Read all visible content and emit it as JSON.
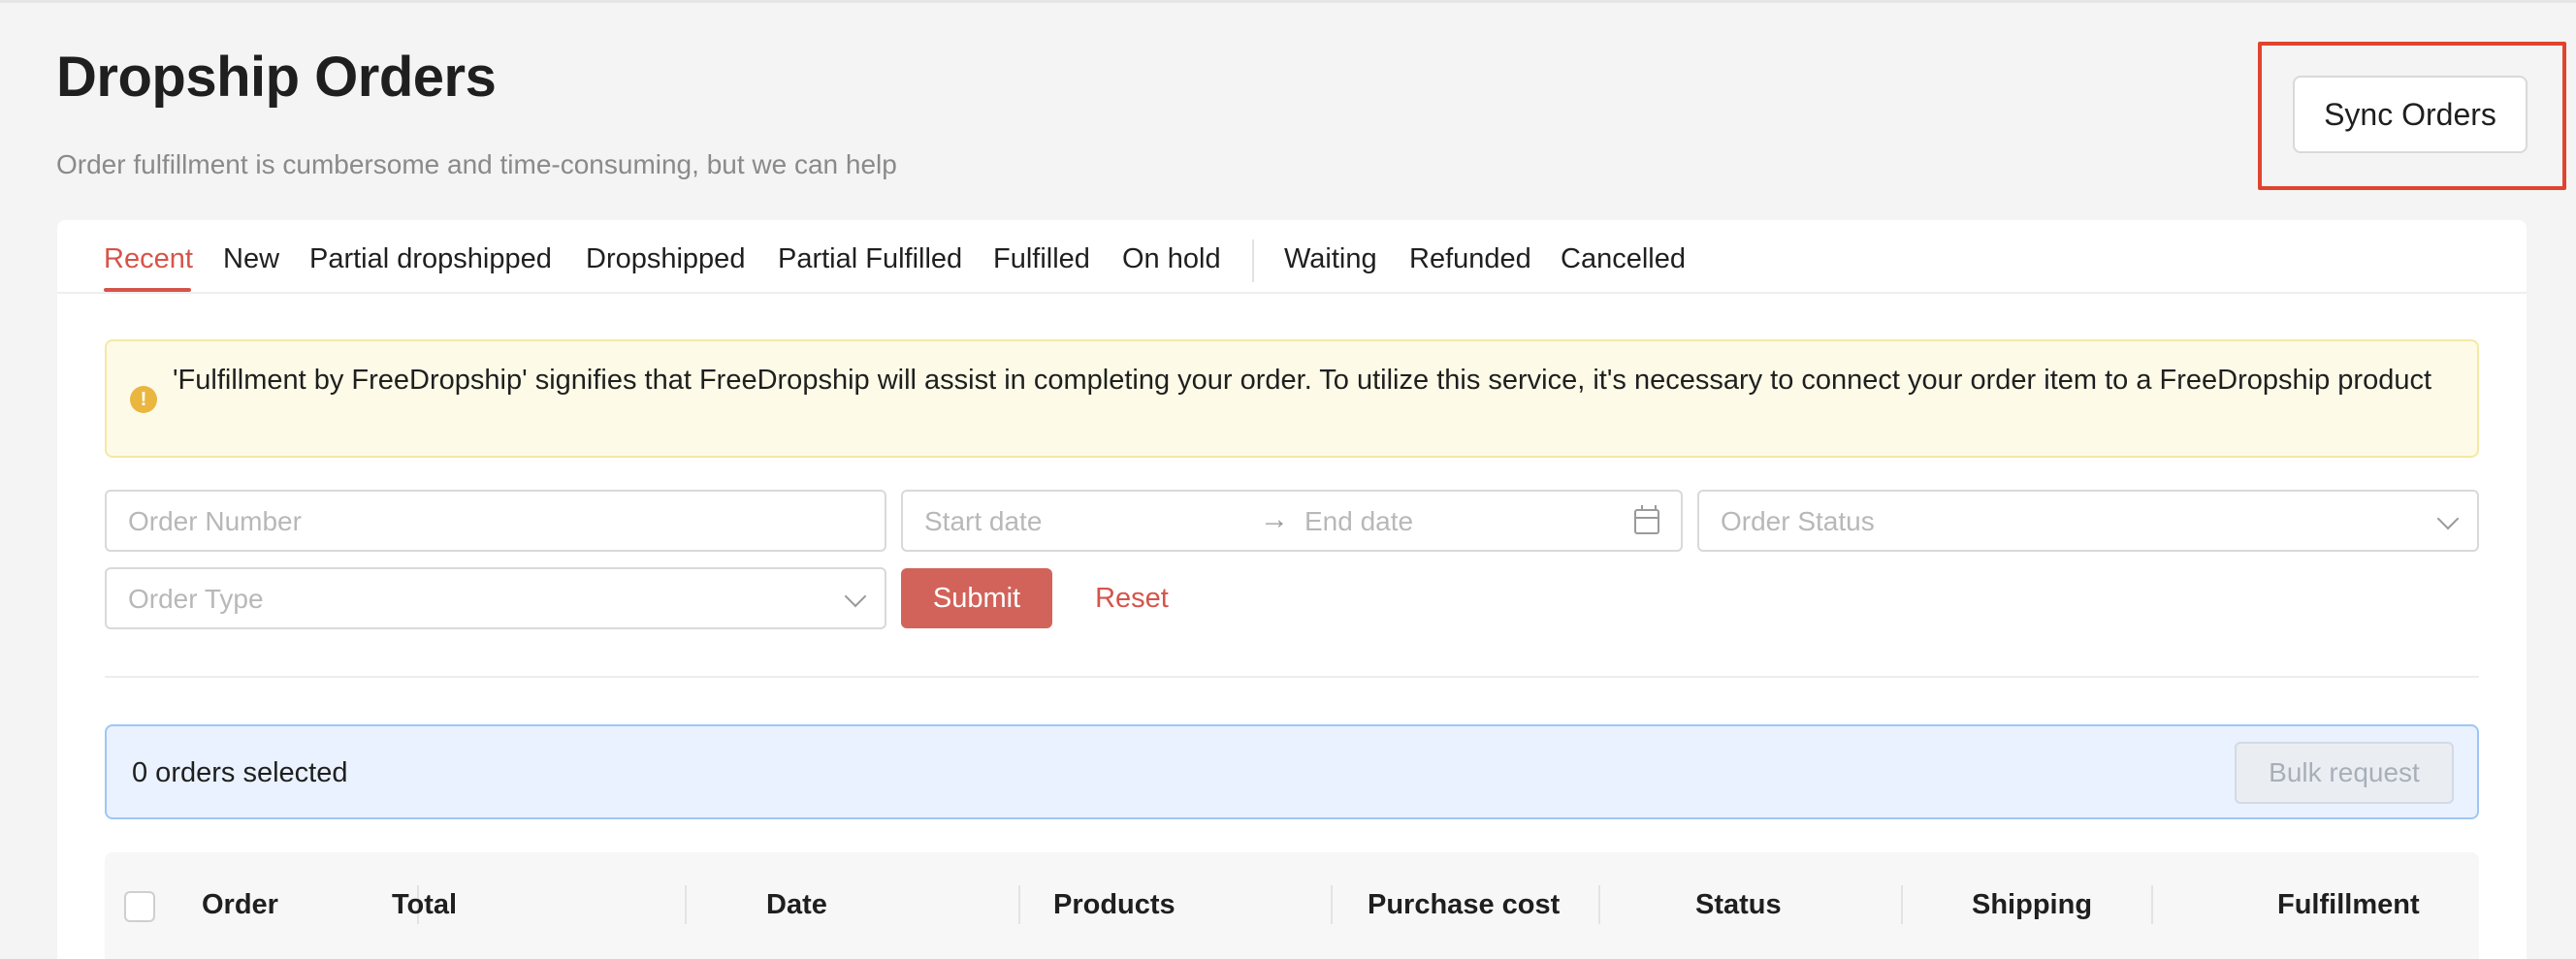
{
  "page": {
    "title": "Dropship Orders",
    "subtitle": "Order fulfillment is cumbersome and time-consuming, but we can help",
    "sync_button": "Sync Orders"
  },
  "tabs": [
    {
      "label": "Recent",
      "active": true
    },
    {
      "label": "New"
    },
    {
      "label": "Partial dropshipped"
    },
    {
      "label": "Dropshipped"
    },
    {
      "label": "Partial Fulfilled"
    },
    {
      "label": "Fulfilled"
    },
    {
      "label": "On hold"
    },
    {
      "label": "Waiting"
    },
    {
      "label": "Refunded"
    },
    {
      "label": "Cancelled"
    }
  ],
  "alert": {
    "icon": "warning-icon",
    "text": "'Fulfillment by FreeDropship' signifies that FreeDropship will assist in completing your order. To utilize this service, it's necessary to connect your order item to a FreeDropship product"
  },
  "filters": {
    "order_number_placeholder": "Order Number",
    "start_date_placeholder": "Start date",
    "end_date_placeholder": "End date",
    "order_status_placeholder": "Order Status",
    "order_type_placeholder": "Order Type",
    "submit_label": "Submit",
    "reset_label": "Reset"
  },
  "selection": {
    "text": "0 orders selected",
    "bulk_label": "Bulk request"
  },
  "table": {
    "columns": [
      "Order",
      "Total",
      "Date",
      "Products",
      "Purchase cost",
      "Status",
      "Shipping",
      "Fulfillment"
    ]
  },
  "colors": {
    "accent": "#d5544a",
    "highlight": "#e0432e",
    "alert_bg": "#fdfbe8",
    "selection_bg": "#e9f2fe"
  }
}
